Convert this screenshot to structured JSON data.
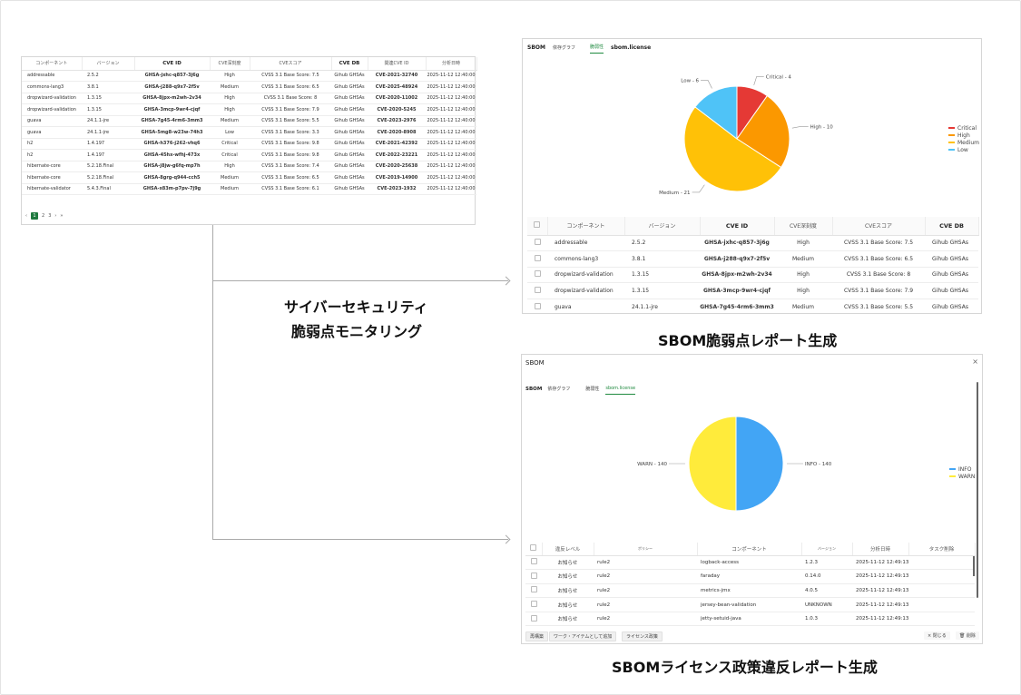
{
  "captions": {
    "monitoring_line1": "サイバーセキュリティ",
    "monitoring_line2": "脆弱点モニタリング",
    "sbom_report": "SBOM脆弱点レポート生成",
    "license_report": "SBOMライセンス政策違反レポート生成"
  },
  "vuln_table": {
    "headers": [
      "コンポーネント",
      "バージョン",
      "CVE ID",
      "CVE深刻度",
      "CVEスコア",
      "CVE DB",
      "関連CVE ID",
      "分析日時"
    ],
    "rows": [
      [
        "addressable",
        "2.5.2",
        "GHSA-jxhc-q857-3j6g",
        "High",
        "CVSS 3.1 Base Score: 7.5",
        "Gihub GHSAs",
        "CVE-2021-32740",
        "2025-11-12 12:40:00"
      ],
      [
        "commons-lang3",
        "3.8.1",
        "GHSA-j288-q9x7-2f5v",
        "Medium",
        "CVSS 3.1 Base Score: 6.5",
        "Gihub GHSAs",
        "CVE-2025-48924",
        "2025-11-12 12:40:00"
      ],
      [
        "dropwizard-validation",
        "1.3.15",
        "GHSA-8jpx-m2wh-2v34",
        "High",
        "CVSS 3.1 Base Score: 8",
        "Gihub GHSAs",
        "CVE-2020-11002",
        "2025-11-12 12:40:00"
      ],
      [
        "dropwizard-validation",
        "1.3.15",
        "GHSA-3mcp-9wr4-cjqf",
        "High",
        "CVSS 3.1 Base Score: 7.9",
        "Gihub GHSAs",
        "CVE-2020-5245",
        "2025-11-12 12:40:00"
      ],
      [
        "guava",
        "24.1.1-jre",
        "GHSA-7g45-4rm6-3mm3",
        "Medium",
        "CVSS 3.1 Base Score: 5.5",
        "Gihub GHSAs",
        "CVE-2023-2976",
        "2025-11-12 12:40:00"
      ],
      [
        "guava",
        "24.1.1-jre",
        "GHSA-5mg8-w23w-74h3",
        "Low",
        "CVSS 3.1 Base Score: 3.3",
        "Gihub GHSAs",
        "CVE-2020-8908",
        "2025-11-12 12:40:00"
      ],
      [
        "h2",
        "1.4.197",
        "GHSA-h376-j262-vhq6",
        "Critical",
        "CVSS 3.1 Base Score: 9.8",
        "Gihub GHSAs",
        "CVE-2021-42392",
        "2025-11-12 12:40:00"
      ],
      [
        "h2",
        "1.4.197",
        "GHSA-45hx-wfhj-473x",
        "Critical",
        "CVSS 3.1 Base Score: 9.8",
        "Gihub GHSAs",
        "CVE-2022-23221",
        "2025-11-12 12:40:00"
      ],
      [
        "hibernate-core",
        "5.2.18.Final",
        "GHSA-j8jw-g6fq-mp7h",
        "High",
        "CVSS 3.1 Base Score: 7.4",
        "Gihub GHSAs",
        "CVE-2020-25638",
        "2025-11-12 12:40:00"
      ],
      [
        "hibernate-core",
        "5.2.18.Final",
        "GHSA-8grg-q944-cch5",
        "Medium",
        "CVSS 3.1 Base Score: 6.5",
        "Gihub GHSAs",
        "CVE-2019-14900",
        "2025-11-12 12:40:00"
      ],
      [
        "hibernate-validator",
        "5.4.3.Final",
        "GHSA-x83m-p7pv-7j9g",
        "Medium",
        "CVSS 3.1 Base Score: 6.1",
        "Gihub GHSAs",
        "CVE-2023-1932",
        "2025-11-12 12:40:00"
      ]
    ],
    "pager": {
      "prev": "‹",
      "current": "1",
      "p2": "2",
      "p3": "3",
      "next": "›",
      "last": "»"
    }
  },
  "sbom_panel": {
    "title": "SBOM",
    "tabs": [
      "依存グラフ",
      "脆弱性",
      "sbom.license"
    ],
    "active_tab": "脆弱性",
    "table_headers": [
      "コンポーネント",
      "バージョン",
      "CVE ID",
      "CVE深刻度",
      "CVEスコア",
      "CVE DB"
    ],
    "rows": [
      [
        "addressable",
        "2.5.2",
        "GHSA-jxhc-q857-3j6g",
        "High",
        "CVSS 3.1 Base Score: 7.5",
        "Gihub GHSAs"
      ],
      [
        "commons-lang3",
        "3.8.1",
        "GHSA-j288-q9x7-2f5v",
        "Medium",
        "CVSS 3.1 Base Score: 6.5",
        "Gihub GHSAs"
      ],
      [
        "dropwizard-validation",
        "1.3.15",
        "GHSA-8jpx-m2wh-2v34",
        "High",
        "CVSS 3.1 Base Score: 8",
        "Gihub GHSAs"
      ],
      [
        "dropwizard-validation",
        "1.3.15",
        "GHSA-3mcp-9wr4-cjqf",
        "High",
        "CVSS 3.1 Base Score: 7.9",
        "Gihub GHSAs"
      ],
      [
        "guava",
        "24.1.1-jre",
        "GHSA-7g45-4rm6-3mm3",
        "Medium",
        "CVSS 3.1 Base Score: 5.5",
        "Gihub GHSAs"
      ]
    ]
  },
  "license_panel": {
    "title": "SBOM",
    "close": "×",
    "tabs": [
      "SBOM",
      "依存グラフ",
      "脆弱性",
      "sbom.license"
    ],
    "active_tab": "sbom.license",
    "table_headers": [
      "違反レベル",
      "ポリシー",
      "コンポーネント",
      "バージョン",
      "分析日時",
      "タスク削除"
    ],
    "rows": [
      [
        "お知らせ",
        "rule2",
        "logback-access",
        "1.2.3",
        "2025-11-12 12:49:13"
      ],
      [
        "お知らせ",
        "rule2",
        "faraday",
        "0.14.0",
        "2025-11-12 12:49:13"
      ],
      [
        "お知らせ",
        "rule2",
        "metrics-jmx",
        "4.0.5",
        "2025-11-12 12:49:13"
      ],
      [
        "お知らせ",
        "rule2",
        "jersey-bean-validation",
        "UNKNOWN",
        "2025-11-12 12:49:13"
      ],
      [
        "お知らせ",
        "rule2",
        "jetty-setuid-java",
        "1.0.3",
        "2025-11-12 12:49:13"
      ]
    ],
    "buttons": {
      "regenerate": "再構築",
      "add_work_item": "ワーク・アイテムとして追加",
      "license_policy": "ライセンス政策",
      "close": "× 閉じる",
      "delete": "🗑 削除"
    }
  },
  "chart_data": [
    {
      "type": "pie",
      "categories": [
        "Critical",
        "High",
        "Medium",
        "Low"
      ],
      "values": [
        4,
        10,
        21,
        6
      ],
      "labels": [
        "Critical - 4",
        "High - 10",
        "Medium - 21",
        "Low - 6"
      ],
      "colors": [
        "#e53935",
        "#fb9800",
        "#ffc107",
        "#4fc3f7"
      ],
      "legend": "right"
    },
    {
      "type": "pie",
      "categories": [
        "INFO",
        "WARN"
      ],
      "values": [
        140,
        140
      ],
      "labels": [
        "INFO - 140",
        "WARN - 140"
      ],
      "colors": [
        "#42a5f5",
        "#ffeb3b"
      ],
      "legend": "right"
    }
  ]
}
